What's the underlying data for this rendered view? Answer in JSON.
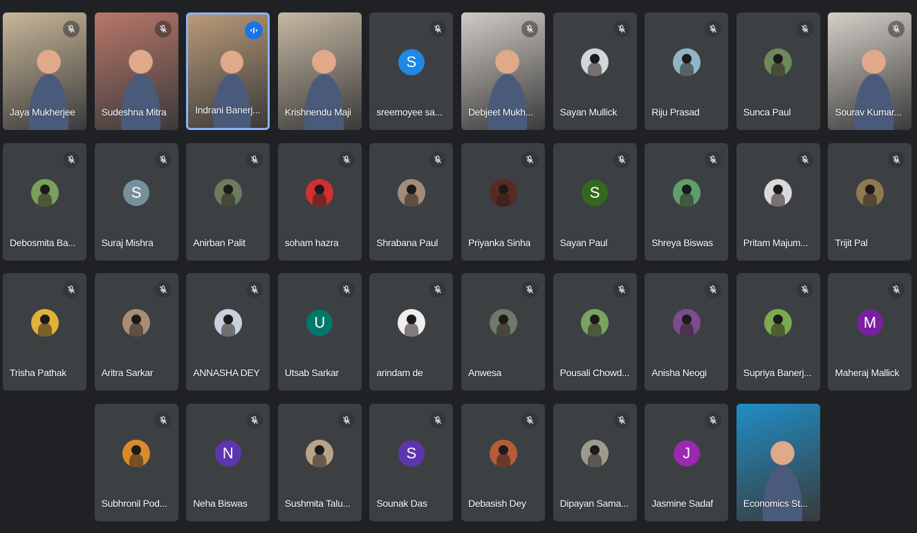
{
  "colors": {
    "background": "#202124",
    "tile": "#3c4043",
    "active_border": "#8ab4f8",
    "speaking_badge": "#1a73e8"
  },
  "participants": [
    {
      "name": "Jaya Mukherjee",
      "type": "video",
      "muted": true,
      "scene": "#c9b79a"
    },
    {
      "name": "Sudeshna Mitra",
      "type": "video",
      "muted": true,
      "scene": "#b8776a"
    },
    {
      "name": "Indrani Banerj...",
      "type": "video",
      "muted": false,
      "speaking": true,
      "active": true,
      "scene": "#b99a78"
    },
    {
      "name": "Krishnendu Maji",
      "type": "video",
      "muted": false,
      "scene": "#c6b8a3"
    },
    {
      "name": "sreemoyee sa...",
      "type": "letter",
      "letter": "S",
      "color": "#1e88e5",
      "muted": true
    },
    {
      "name": "Debjeet Mukh...",
      "type": "video",
      "muted": true,
      "scene": "#cfcac4"
    },
    {
      "name": "Sayan Mullick",
      "type": "photo",
      "muted": true,
      "color": "#cfd7d9"
    },
    {
      "name": "Riju Prasad",
      "type": "photo",
      "muted": true,
      "color": "#8fb6c6"
    },
    {
      "name": "Sunca Paul",
      "type": "photo",
      "muted": true,
      "color": "#6d8a5a"
    },
    {
      "name": "Sourav Kumar...",
      "type": "video",
      "muted": true,
      "scene": "#d5cfc8"
    },
    {
      "name": "Debosmita Ba...",
      "type": "photo",
      "muted": true,
      "color": "#7aa05a"
    },
    {
      "name": "Suraj Mishra",
      "type": "letter",
      "letter": "S",
      "color": "#78909c",
      "muted": true
    },
    {
      "name": "Anirban Palit",
      "type": "photo",
      "muted": true,
      "color": "#6b7c5d"
    },
    {
      "name": "soham hazra",
      "type": "photo",
      "muted": true,
      "color": "#d32f2f"
    },
    {
      "name": "Shrabana Paul",
      "type": "photo",
      "muted": true,
      "color": "#a28b78"
    },
    {
      "name": "Priyanka Sinha",
      "type": "photo",
      "muted": true,
      "color": "#5a2a22"
    },
    {
      "name": "Sayan Paul",
      "type": "letter",
      "letter": "S",
      "color": "#33691e",
      "muted": true
    },
    {
      "name": "Shreya Biswas",
      "type": "photo",
      "muted": true,
      "color": "#5f9f6e"
    },
    {
      "name": "Pritam Majum...",
      "type": "photo",
      "muted": true,
      "color": "#d9d9d9"
    },
    {
      "name": "Trijit Pal",
      "type": "photo",
      "muted": true,
      "color": "#8f7a4e"
    },
    {
      "name": "Trisha Pathak",
      "type": "photo",
      "muted": true,
      "color": "#e0b23a"
    },
    {
      "name": "Aritra Sarkar",
      "type": "photo",
      "muted": true,
      "color": "#a68e73"
    },
    {
      "name": "ANNASHA DEY",
      "type": "photo",
      "muted": true,
      "color": "#c6d2dd"
    },
    {
      "name": "Utsab Sarkar",
      "type": "letter",
      "letter": "U",
      "color": "#00796b",
      "muted": true
    },
    {
      "name": "arindam de",
      "type": "photo",
      "muted": true,
      "color": "#eeeeee"
    },
    {
      "name": "Anwesa",
      "type": "photo",
      "muted": true,
      "color": "#6d7a6a"
    },
    {
      "name": "Pousali Chowd...",
      "type": "photo",
      "muted": true,
      "color": "#79a35e"
    },
    {
      "name": "Anisha Neogi",
      "type": "photo",
      "muted": true,
      "color": "#7b4d8f"
    },
    {
      "name": "Supriya Banerj...",
      "type": "photo",
      "muted": true,
      "color": "#7eaa4f"
    },
    {
      "name": "Maheraj Mallick",
      "type": "letter",
      "letter": "M",
      "color": "#7b1fa2",
      "muted": true
    },
    {
      "name": "Subhronil Pod...",
      "type": "photo",
      "muted": true,
      "color": "#d98b2b"
    },
    {
      "name": "Neha Biswas",
      "type": "letter",
      "letter": "N",
      "color": "#5e35b1",
      "muted": true
    },
    {
      "name": "Sushmita Talu...",
      "type": "photo",
      "muted": true,
      "color": "#b7a58a"
    },
    {
      "name": "Sounak Das",
      "type": "letter",
      "letter": "S",
      "color": "#5e35b1",
      "muted": true
    },
    {
      "name": "Debasish Dey",
      "type": "photo",
      "muted": true,
      "color": "#b55c3a"
    },
    {
      "name": "Dipayan Sama...",
      "type": "photo",
      "muted": true,
      "color": "#9c9c8e"
    },
    {
      "name": "Jasmine Sadaf",
      "type": "letter",
      "letter": "J",
      "color": "#9c27b0",
      "muted": true
    },
    {
      "name": "Economics St...",
      "type": "video",
      "muted": false,
      "scene": "#1f8ec7"
    }
  ]
}
